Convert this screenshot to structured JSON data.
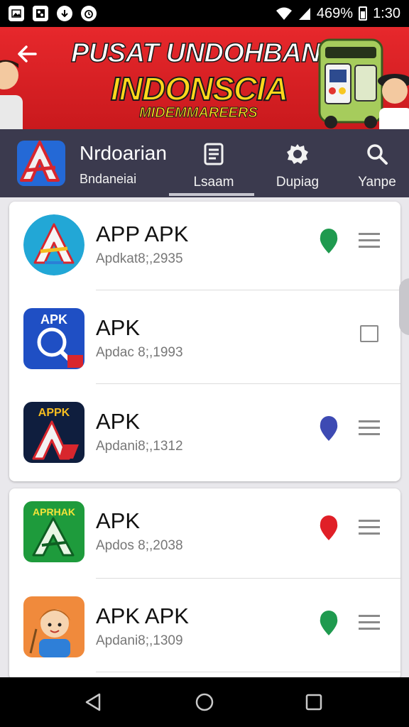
{
  "status_bar": {
    "battery": "469%",
    "time": "1:30"
  },
  "banner": {
    "title": "PUSAT UNDOHBAN",
    "subtitle": "INDONSCIA",
    "tagline": "MIDEMMAREERS"
  },
  "header": {
    "brand_name": "Nrdoarian",
    "brand_sub": "Bndaneiai",
    "tabs": [
      {
        "label": "Lsaam",
        "icon": "list-icon",
        "active": true
      },
      {
        "label": "Dupiag",
        "icon": "gear-icon",
        "active": false
      },
      {
        "label": "Yanpe",
        "icon": "search-icon",
        "active": false
      }
    ]
  },
  "apps": [
    {
      "title": "APP APK",
      "sub": "Apdkat8;,2935",
      "status_color": "#1f9a4f",
      "action": "menu"
    },
    {
      "title": "APK",
      "sub": "Apdac 8;,1993",
      "status_color": "",
      "action": "checkbox"
    },
    {
      "title": "APK",
      "sub": "Apdani8;,1312",
      "status_color": "#3d4ab3",
      "action": "menu"
    },
    {
      "title": "APK",
      "sub": "Apdos 8;,2038",
      "status_color": "#e01f27",
      "action": "menu"
    },
    {
      "title": "APK APK",
      "sub": "Apdani8;,1309",
      "status_color": "#1f9a4f",
      "action": "menu"
    }
  ],
  "icon_labels": {
    "app2": "APK",
    "app3": "APPK",
    "app4": "APRHAK"
  },
  "colors": {
    "banner_red": "#e7282c",
    "header_bg": "#3b3a4e",
    "accent_yellow": "#ffd81c"
  }
}
